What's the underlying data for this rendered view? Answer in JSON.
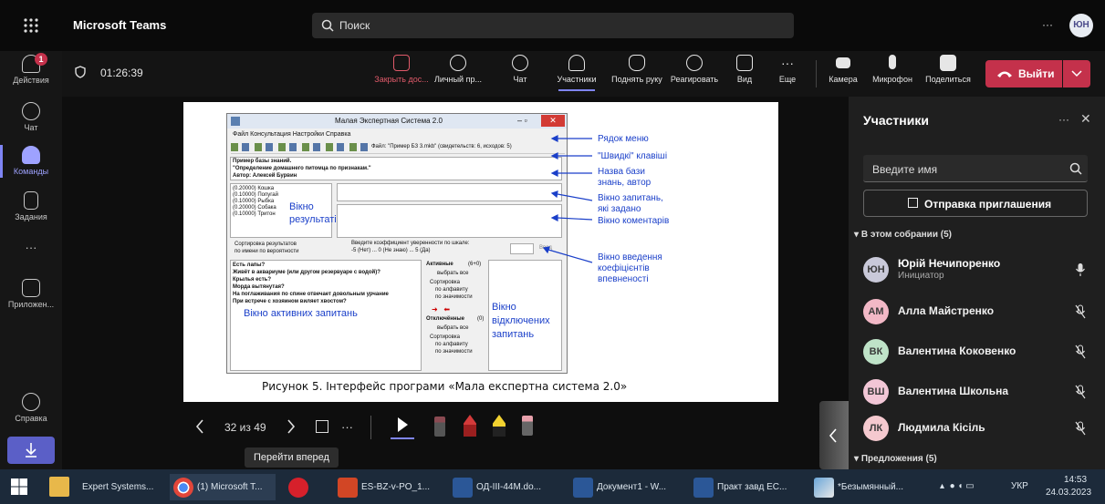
{
  "app": {
    "title": "Microsoft Teams",
    "user_initials": "ЮН",
    "more": "···"
  },
  "search": {
    "placeholder": "Поиск"
  },
  "rail": [
    {
      "label": "Действия",
      "badge": "1"
    },
    {
      "label": "Чат"
    },
    {
      "label": "Команды"
    },
    {
      "label": "Задания"
    },
    {
      "label": "···"
    },
    {
      "label": "Приложен..."
    },
    {
      "label": "Справка"
    }
  ],
  "meeting": {
    "timer": "01:26:39",
    "buttons": {
      "close_share": "Закрыть дос...",
      "personal": "Личный пр...",
      "chat": "Чат",
      "participants": "Участники",
      "raise_hand": "Поднять руку",
      "react": "Реагировать",
      "view": "Вид",
      "more": "Еще",
      "camera": "Камера",
      "mic": "Микрофон",
      "share": "Поделиться",
      "leave": "Выйти"
    }
  },
  "slide": {
    "window_title": "Малая Экспертная Система 2.0",
    "menu": "Файл  Консультация  Настройки  Справка",
    "file_info": "Файл: \"Пример БЗ 3.mkb\" (свидетельств: 6, исходов: 5)",
    "kb_text": [
      "Пример базы знаний.",
      "\"Определение домашнего питомца по признакам.\"",
      "Автор: Алексей Бурвин"
    ],
    "results": [
      "(0.20000) Кошка",
      "(0.10000) Попугай",
      "(0.10000) Рыбка",
      "(0.20000) Собака",
      "(0.10000) Тритон"
    ],
    "results_label": [
      "Вікно",
      "результатів"
    ],
    "sort_label": "Сортировка результатов",
    "sort_opts": "по имени    по вероятности",
    "coef_label": "Введите коэффициент уверенности по шкале:",
    "coef_scale": "-5 (Нет) ... 0 (Не знаю) ... 5 (Да)",
    "coef_btn": "Ввод",
    "questions": [
      "Есть лапы?",
      "Живёт в аквариуме (или другом резервуаре с водой)?",
      "Крылья есть?",
      "Морда вытянутая?",
      "На поглаживания по спине отвечает довольным урчание",
      "При встрече с хозяином виляет хвостом?"
    ],
    "active_label": "Вікно активних запитань",
    "active_hdr": "Активные",
    "active_count": "(6+0)",
    "select_all": "выбрать все",
    "sorting": "Сортировка",
    "by_alpha": "по алфавиту",
    "by_value": "по значимости",
    "disabled_hdr": "Отключённые",
    "disabled_count": "(0)",
    "disabled_label": [
      "Вікно",
      "відключених",
      "запитань"
    ],
    "annotations": [
      "Рядок меню",
      "\"Швидкі\" клавіші",
      "Назва бази",
      "знань, автор",
      "Вікно запитань,",
      "які задано",
      "Вікно коментарів",
      "Вікно введення",
      "коефіцієнтів",
      "впевненості"
    ],
    "caption": "Рисунок 5. Інтерфейс програми «Мала експертна система 2.0»"
  },
  "presenter": {
    "page": "32 из 49",
    "tooltip": "Перейти вперед",
    "more": "···"
  },
  "panel": {
    "title": "Участники",
    "search_placeholder": "Введите имя",
    "invite": "Отправка приглашения",
    "in_meeting": "В этом собрании (5)",
    "suggestions": "Предложения (5)",
    "people": [
      {
        "initials": "ЮН",
        "name": "Юрій Нечипоренко",
        "role": "Инициатор",
        "color": "#c9c9d9",
        "muted": false
      },
      {
        "initials": "АМ",
        "name": "Алла Майстренко",
        "color": "#f2b8c6",
        "muted": true
      },
      {
        "initials": "ВК",
        "name": "Валентина Коковенко",
        "color": "#bfe3c8",
        "muted": true
      },
      {
        "initials": "ВШ",
        "name": "Валентина Школьна",
        "color": "#f2c6d6",
        "muted": true
      },
      {
        "initials": "ЛК",
        "name": "Людмила Кісіль",
        "color": "#f5c9cf",
        "muted": true
      }
    ]
  },
  "taskbar": {
    "items": [
      "Expert Systems...",
      "(1) Microsoft T...",
      "",
      "ES-BZ-v-PO_1...",
      "ОД-ІІІ-44М.do...",
      "Документ1 - W...",
      "Практ завд ЕС...",
      "*Безымянный..."
    ],
    "lang": "УКР",
    "time": "14:53",
    "date": "24.03.2023"
  },
  "colors": {
    "accent": "#5b5fc7",
    "leave": "#c4314b",
    "annotation": "#1a3fc9"
  }
}
